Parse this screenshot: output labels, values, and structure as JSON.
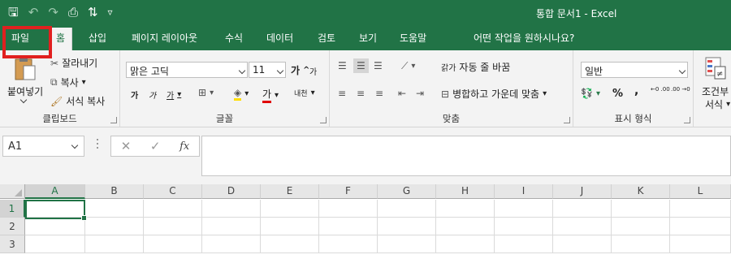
{
  "window": {
    "title": "통합 문서1  -  Excel"
  },
  "quick_access": [
    {
      "name": "save-icon",
      "glyph": "🖫"
    },
    {
      "name": "undo-icon",
      "glyph": "↶"
    },
    {
      "name": "redo-icon",
      "glyph": "↷"
    },
    {
      "name": "print-preview-icon",
      "glyph": "⎙"
    },
    {
      "name": "sort-icon",
      "glyph": "⇅"
    },
    {
      "name": "customize-qat-icon",
      "glyph": "▿"
    }
  ],
  "tabs": [
    {
      "id": "file",
      "label": "파일"
    },
    {
      "id": "home",
      "label": "홈"
    },
    {
      "id": "insert",
      "label": "삽입"
    },
    {
      "id": "page-layout",
      "label": "페이지 레이아웃"
    },
    {
      "id": "formulas",
      "label": "수식"
    },
    {
      "id": "data",
      "label": "데이터"
    },
    {
      "id": "review",
      "label": "검토"
    },
    {
      "id": "view",
      "label": "보기"
    },
    {
      "id": "help",
      "label": "도움말"
    }
  ],
  "tell_me": "어떤 작업을 원하시나요?",
  "ribbon": {
    "clipboard": {
      "label": "클립보드",
      "paste": "붙여넣기",
      "cut": "잘라내기",
      "copy": "복사",
      "format_painter": "서식 복사"
    },
    "font": {
      "label": "글꼴",
      "font_name": "맑은 고딕",
      "font_size": "11",
      "grow": "가",
      "shrink": "가",
      "bold": "가",
      "italic": "가",
      "underline": "가",
      "font_color": "가",
      "phonetic": "내천"
    },
    "alignment": {
      "label": "맞춤",
      "wrap_text": "자동 줄 바꿈",
      "merge_center": "병합하고 가운데 맞춤",
      "wrap_icon_text": "갉가"
    },
    "number": {
      "label": "표시 형식",
      "format": "일반",
      "percent": "%",
      "comma": ",",
      "inc_decimal": "←0 .00",
      "dec_decimal": ".00 →0"
    },
    "styles": {
      "conditional": "조건부",
      "conditional2": "서식"
    }
  },
  "formula_bar": {
    "name_box": "A1",
    "cancel": "✕",
    "enter": "✓",
    "fx": "fx",
    "value": ""
  },
  "sheet": {
    "columns": [
      "A",
      "B",
      "C",
      "D",
      "E",
      "F",
      "G",
      "H",
      "I",
      "J",
      "K",
      "L"
    ],
    "rows": [
      "1",
      "2",
      "3"
    ],
    "selected_cell": "A1"
  },
  "colors": {
    "accent": "#217346",
    "highlight": "#e1201f"
  }
}
